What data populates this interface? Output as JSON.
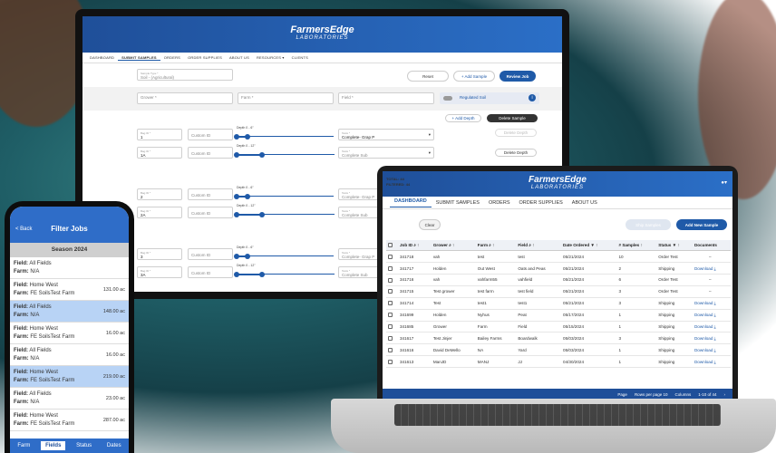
{
  "brand": {
    "name": "FarmersEdge",
    "sub": "LABORATORIES"
  },
  "monitor": {
    "nav": [
      "DASHBOARD",
      "SUBMIT SAMPLES",
      "ORDERS",
      "ORDER SUPPLIES",
      "ABOUT US",
      "RESOURCES",
      "CLIENTS"
    ],
    "active_nav": "SUBMIT SAMPLES",
    "resources_chevron": "chevron-down-icon",
    "sample_type_label": "Sample Type *",
    "sample_type_value": "Soil - (Agricultural)",
    "reset": "Reset",
    "add_sample": "+ Add Sample",
    "review_job": "Review Job",
    "grower_placeholder": "Grower *",
    "farm_placeholder": "Farm *",
    "field_placeholder": "Field *",
    "regulated_soil": "Regulated Soil",
    "add_depth": "+ Add Depth",
    "delete_sample": "Delete Sample",
    "delete_depth": "Delete Depth",
    "custom_id": "Custom ID",
    "bag_id_label": "Bag ID *",
    "depth1": "Depth 0 - 6\"",
    "depth2": "Depth 0 - 12\"",
    "tests_label": "Tests *",
    "test_value": "Complete- Grap P",
    "test_value2": "Complete Sub",
    "samples": [
      {
        "bag1": "1",
        "bag2": "1A"
      },
      {
        "bag1": "2",
        "bag2": "2A"
      },
      {
        "bag1": "3",
        "bag2": "3A"
      }
    ]
  },
  "laptop": {
    "user_icon": "person-icon",
    "nav": [
      "DASHBOARD",
      "SUBMIT SAMPLES",
      "ORDERS",
      "ORDER SUPPLIES",
      "ABOUT US"
    ],
    "active_nav": "DASHBOARD",
    "total": "TOTAL: 44",
    "filtered": "FILTERED: 44",
    "clear": "Clear",
    "ship_samples": "Ship Samples",
    "add_new_sample": "Add New Sample",
    "columns": [
      "Job ID",
      "Grower",
      "Farm",
      "Field",
      "Date Ordered",
      "# Samples",
      "Status",
      "Documents"
    ],
    "rows": [
      {
        "id": "341718",
        "grower": "vah",
        "farm": "test",
        "field": "test",
        "date": "05/21/2024",
        "samples": "10",
        "status": "Order Test",
        "doc": "–"
      },
      {
        "id": "341717",
        "grower": "Holden",
        "farm": "Out West",
        "field": "Oats and Peas",
        "date": "05/21/2024",
        "samples": "2",
        "status": "Shipping",
        "doc": "Download"
      },
      {
        "id": "341716",
        "grower": "vah",
        "farm": "vahfarm55",
        "field": "vahfield",
        "date": "05/21/2024",
        "samples": "6",
        "status": "Order Test",
        "doc": "–"
      },
      {
        "id": "341715",
        "grower": "Test grower",
        "farm": "test farm",
        "field": "test field",
        "date": "05/21/2024",
        "samples": "3",
        "status": "Order Test",
        "doc": "–"
      },
      {
        "id": "341714",
        "grower": "Test",
        "farm": "test1",
        "field": "test1",
        "date": "05/21/2024",
        "samples": "3",
        "status": "Shipping",
        "doc": "Download"
      },
      {
        "id": "341699",
        "grower": "Holden",
        "farm": "Nyhus",
        "field": "Peat",
        "date": "05/17/2024",
        "samples": "1",
        "status": "Shipping",
        "doc": "Download"
      },
      {
        "id": "341685",
        "grower": "Grower",
        "farm": "Farm",
        "field": "Field",
        "date": "05/15/2024",
        "samples": "1",
        "status": "Shipping",
        "doc": "Download"
      },
      {
        "id": "341617",
        "grower": "Test Jinjer",
        "farm": "Bailey Farms",
        "field": "Boardwalk",
        "date": "05/03/2024",
        "samples": "3",
        "status": "Shipping",
        "doc": "Download"
      },
      {
        "id": "341616",
        "grower": "David DeMello",
        "farm": "NA",
        "field": "Yard",
        "date": "05/03/2024",
        "samples": "1",
        "status": "Shipping",
        "doc": "Download"
      },
      {
        "id": "341613",
        "grower": "ManJD",
        "farm": "MANJ",
        "field": "JJ",
        "date": "04/30/2024",
        "samples": "1",
        "status": "Shipping",
        "doc": "Download"
      }
    ],
    "pager": {
      "page": "Page",
      "rows_per_page": "Rows per page 10",
      "columns": "Columns",
      "range": "1-10 of 44"
    }
  },
  "phone": {
    "back": "< Back",
    "title": "Filter Jobs",
    "season": "Season 2024",
    "items": [
      {
        "field": "All Fields",
        "farm": "N/A",
        "acres": "",
        "sel": false
      },
      {
        "field": "Home West",
        "farm": "FE SoilsTest Farm",
        "acres": "131.00 ac",
        "sel": false
      },
      {
        "field": "All Fields",
        "farm": "N/A",
        "acres": "148.00 ac",
        "sel": true
      },
      {
        "field": "Home West",
        "farm": "FE SoilsTest Farm",
        "acres": "16.00 ac",
        "sel": false
      },
      {
        "field": "All Fields",
        "farm": "N/A",
        "acres": "16.00 ac",
        "sel": false
      },
      {
        "field": "Home West",
        "farm": "FE SoilsTest Farm",
        "acres": "219.00 ac",
        "sel": true
      },
      {
        "field": "All Fields",
        "farm": "N/A",
        "acres": "23.00 ac",
        "sel": false
      },
      {
        "field": "Home West",
        "farm": "FE SoilsTest Farm",
        "acres": "287.00 ac",
        "sel": false
      }
    ],
    "tabs": [
      "Farm",
      "Fields",
      "Status",
      "Dates"
    ],
    "active_tab": "Fields"
  }
}
